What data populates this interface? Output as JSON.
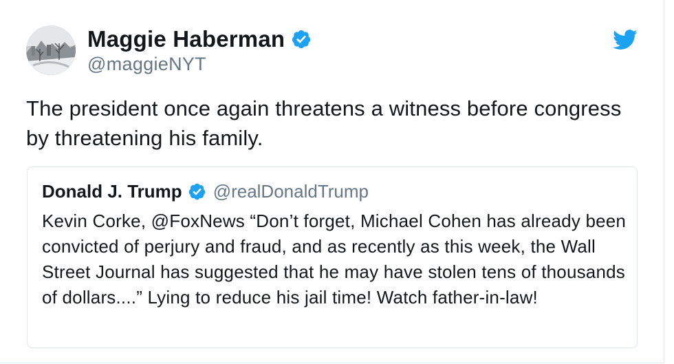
{
  "tweet": {
    "author_name": "Maggie Haberman",
    "author_handle": "@maggieNYT",
    "author_verified": true,
    "text": "The president once again threatens a witness before congress by threatening his family.",
    "brand_icon": "twitter-bird-icon",
    "brand_color": "#1da1f2"
  },
  "quoted_tweet": {
    "author_name": "Donald J. Trump",
    "author_handle": "@realDonaldTrump",
    "author_verified": true,
    "text": "Kevin Corke, @FoxNews “Don’t forget, Michael Cohen has already been convicted of perjury and fraud, and as recently as this week, the Wall Street Journal has suggested that he may have stolen tens of thousands of dollars....”  Lying to reduce his jail time! Watch father-in-law!"
  },
  "colors": {
    "text_primary": "#14171a",
    "text_secondary": "#657786",
    "verified_badge": "#1da1f2",
    "border": "#e1e8ed"
  }
}
